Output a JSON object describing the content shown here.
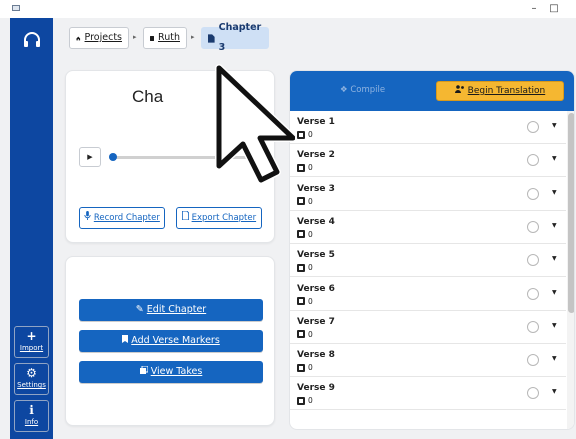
{
  "window": {
    "minimize": "–",
    "maximize": "□"
  },
  "sidebar": {
    "import_label": "Import",
    "settings_label": "Settings",
    "info_label": "Info",
    "import_icon": "+",
    "settings_icon": "⚙",
    "info_icon": "ℹ"
  },
  "breadcrumb": {
    "projects": "Projects",
    "book": "Ruth",
    "chapter": "Chapter 3",
    "sep": "▸"
  },
  "player": {
    "title": "Cha",
    "play": "▶",
    "progress": 0.0
  },
  "actions": {
    "record": "Record Chapter",
    "export": "Export Chapter",
    "edit": "Edit Chapter",
    "add_markers": "Add Verse Markers",
    "view_takes": "View Takes"
  },
  "verse_panel": {
    "compile": "Compile",
    "begin": "Begin Translation",
    "verses": [
      {
        "name": "Verse 1",
        "takes": "0"
      },
      {
        "name": "Verse 2",
        "takes": "0"
      },
      {
        "name": "Verse 3",
        "takes": "0"
      },
      {
        "name": "Verse 4",
        "takes": "0"
      },
      {
        "name": "Verse 5",
        "takes": "0"
      },
      {
        "name": "Verse 6",
        "takes": "0"
      },
      {
        "name": "Verse 7",
        "takes": "0"
      },
      {
        "name": "Verse 8",
        "takes": "0"
      },
      {
        "name": "Verse 9",
        "takes": "0"
      }
    ]
  },
  "colors": {
    "primary": "#1565c0",
    "sidebar": "#0d47a1",
    "accent": "#f5b731"
  },
  "icons": {
    "home": "home-icon",
    "book": "book-icon",
    "document": "document-icon",
    "mic": "mic-icon",
    "export": "export-icon",
    "pencil": "pencil-icon",
    "bookmark": "bookmark-icon",
    "takes": "takes-icon",
    "users": "users-icon",
    "cursor": "mouse-cursor-icon"
  }
}
